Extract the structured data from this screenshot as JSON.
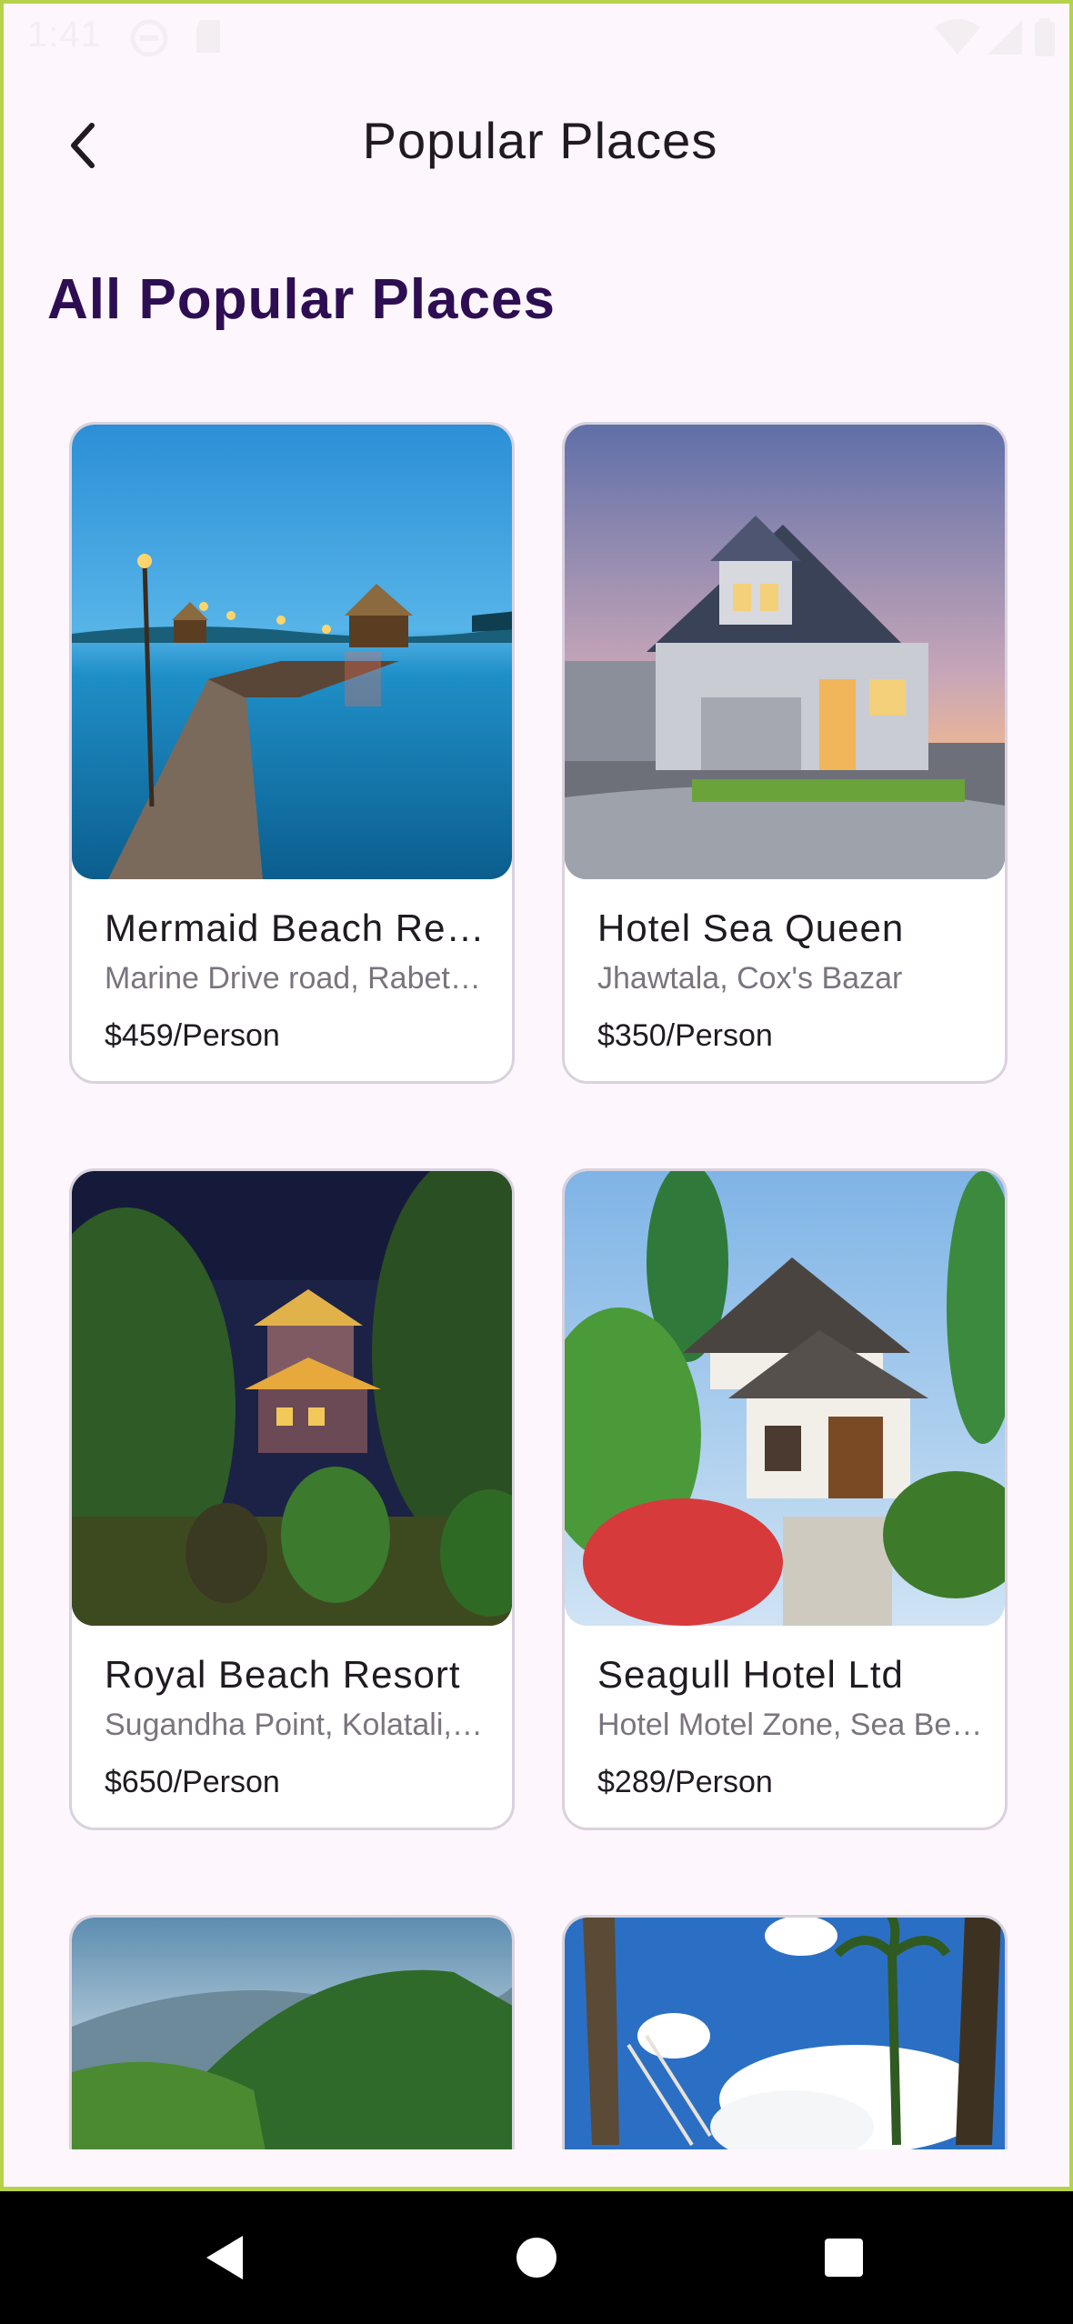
{
  "status_bar": {
    "time": "1:41"
  },
  "app_bar": {
    "title": "Popular Places"
  },
  "section": {
    "title": "All Popular Places"
  },
  "places": [
    {
      "name": "Mermaid Beach Resort",
      "address": "Marine Drive road, Rabeta, Cox's Bazar",
      "price": "$459/Person",
      "image": "lake-pier-photo"
    },
    {
      "name": "Hotel Sea Queen",
      "address": "Jhawtala, Cox's Bazar",
      "price": "$350/Person",
      "image": "suburban-house-photo"
    },
    {
      "name": "Royal Beach Resort",
      "address": "Sugandha Point, Kolatali, Cox's Bazar",
      "price": "$650/Person",
      "image": "night-pagoda-photo"
    },
    {
      "name": "Seagull Hotel Ltd",
      "address": "Hotel Motel Zone, Sea Beach, Cox's Bazar",
      "price": "$289/Person",
      "image": "japanese-house-photo"
    },
    {
      "name": "",
      "address": "",
      "price": "",
      "image": "green-hills-photo"
    },
    {
      "name": "",
      "address": "",
      "price": "",
      "image": "palm-beach-photo"
    }
  ],
  "nav": {
    "back_icon": "triangle-back-icon",
    "home_icon": "circle-home-icon",
    "recents_icon": "square-recents-icon"
  },
  "colors": {
    "background": "#fdf7fd",
    "section_title": "#2d0e52",
    "frame_border": "#b4d34a"
  }
}
